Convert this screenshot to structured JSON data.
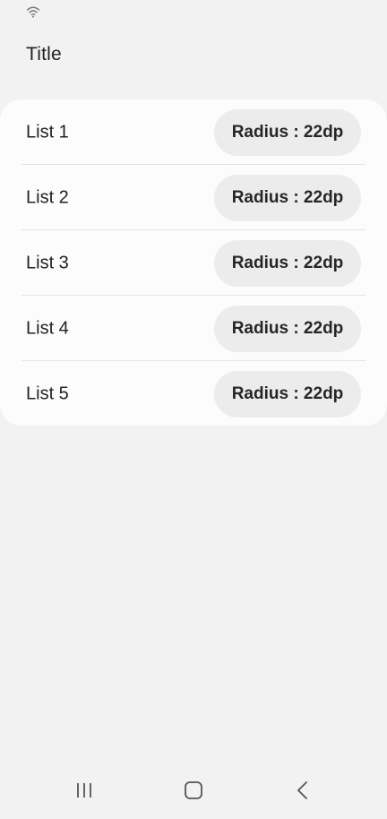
{
  "title": "Title",
  "list": {
    "items": [
      {
        "label": "List 1",
        "button_label": "Radius : 22dp"
      },
      {
        "label": "List 2",
        "button_label": "Radius : 22dp"
      },
      {
        "label": "List 3",
        "button_label": "Radius : 22dp"
      },
      {
        "label": "List 4",
        "button_label": "Radius : 22dp"
      },
      {
        "label": "List 5",
        "button_label": "Radius : 22dp"
      }
    ]
  },
  "status_bar": {
    "icons": [
      "wifi-icon"
    ]
  },
  "nav_bar": {
    "icons": [
      "recent-apps-icon",
      "home-icon",
      "back-icon"
    ]
  },
  "colors": {
    "background": "#f2f2f2",
    "card": "#fcfcfc",
    "button": "#ececec",
    "text": "#222222"
  }
}
